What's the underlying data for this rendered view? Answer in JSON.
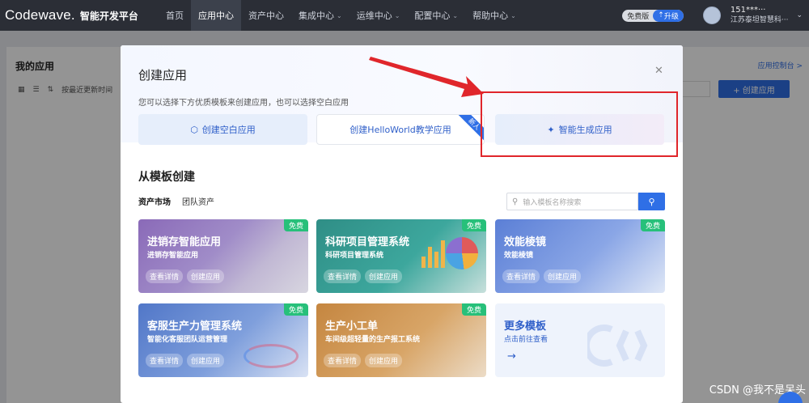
{
  "nav": {
    "logo_text": "Codewave.",
    "logo_sub": "智能开发平台",
    "items": [
      {
        "label": "首页",
        "active": false,
        "has_menu": false
      },
      {
        "label": "应用中心",
        "active": true,
        "has_menu": false
      },
      {
        "label": "资产中心",
        "active": false,
        "has_menu": false
      },
      {
        "label": "集成中心",
        "active": false,
        "has_menu": true
      },
      {
        "label": "运维中心",
        "active": false,
        "has_menu": true
      },
      {
        "label": "配置中心",
        "active": false,
        "has_menu": true
      },
      {
        "label": "帮助中心",
        "active": false,
        "has_menu": true
      }
    ],
    "free_badge": "免费版",
    "upgrade_label": "升级",
    "user_id": "151***···",
    "user_org": "江苏泰坦智慧科···"
  },
  "background_page": {
    "title": "我的应用",
    "console_link": "应用控制台 >",
    "sort_label": "按最近更新时间",
    "create_button": "+ 创建应用"
  },
  "modal": {
    "title": "创建应用",
    "subtitle": "您可以选择下方优质模板来创建应用，也可以选择空白应用",
    "options": {
      "blank": "创建空白应用",
      "hello": "创建HelloWorld教学应用",
      "hello_ribbon": "新人",
      "smart": "智能生成应用"
    },
    "section_title": "从模板创建",
    "tabs": [
      "资产市场",
      "团队资产"
    ],
    "search_placeholder": "输入模板名称搜索",
    "free_tag": "免费",
    "view_label": "查看详情",
    "create_label": "创建应用",
    "cards": [
      {
        "title": "进销存智能应用",
        "subtitle": "进销存智能应用"
      },
      {
        "title": "科研项目管理系统",
        "subtitle": "科研项目管理系统"
      },
      {
        "title": "效能棱镜",
        "subtitle": "效能棱镜"
      },
      {
        "title": "客服生产力管理系统",
        "subtitle": "智能化客服团队运营管理"
      },
      {
        "title": "生产小工单",
        "subtitle": "车间级超轻量的生产报工系统"
      }
    ],
    "more": {
      "title": "更多模板",
      "subtitle": "点击前往查看",
      "arrow": "→"
    }
  },
  "watermark": "CSDN @我不是呆头",
  "colors": {
    "accent": "#2f6fe6",
    "highlight_box": "#e0262b",
    "free_tag": "#27c07a",
    "nav_bg": "#2b2e36"
  }
}
